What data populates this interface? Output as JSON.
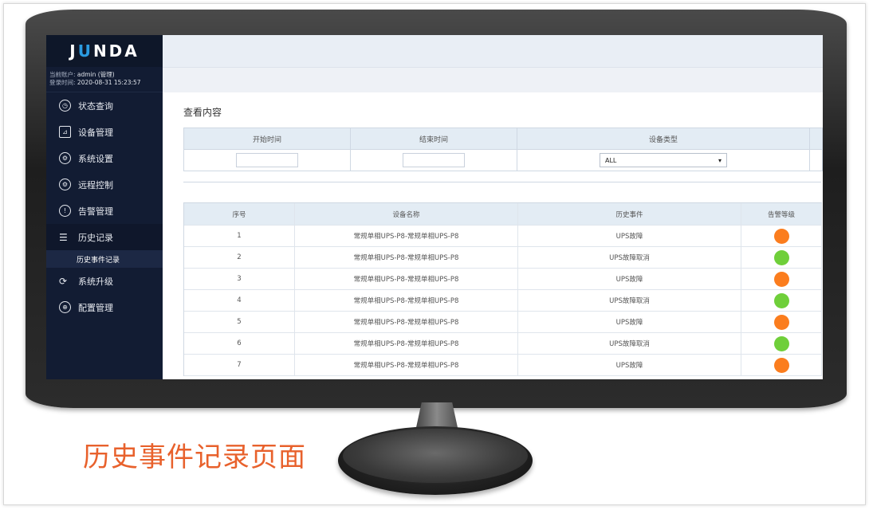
{
  "colors": {
    "alarm": "#fb7d1e",
    "cleared": "#6fcf3a",
    "sidebar": "#121c33",
    "caption": "#e8612c"
  },
  "logo": {
    "left": "J",
    "accent": "U",
    "right": "NDA"
  },
  "user": {
    "account_label": "当前账户:",
    "account_value": "admin (管理)",
    "login_label": "登录时间:",
    "login_value": "2020-08-31 15:23:57"
  },
  "sidebar": {
    "items": [
      {
        "label": "状态查询",
        "icon": "clock-icon"
      },
      {
        "label": "设备管理",
        "icon": "chart-icon"
      },
      {
        "label": "系统设置",
        "icon": "gear-icon"
      },
      {
        "label": "远程控制",
        "icon": "gear-icon"
      },
      {
        "label": "告警管理",
        "icon": "alert-icon"
      },
      {
        "label": "历史记录",
        "icon": "list-icon"
      },
      {
        "label": "系统升级",
        "icon": "refresh-icon"
      },
      {
        "label": "配置管理",
        "icon": "globe-icon"
      }
    ],
    "sub_item": "历史事件记录"
  },
  "page_title": "查看内容",
  "filter": {
    "start_label": "开始时间",
    "end_label": "结束时间",
    "type_label": "设备类型",
    "start_value": "",
    "end_value": "",
    "type_value": "ALL"
  },
  "table": {
    "headers": [
      "序号",
      "设备名称",
      "历史事件",
      "告警等级"
    ],
    "rows": [
      {
        "index": "1",
        "device": "常规单相UPS-P8-常规单相UPS-P8",
        "event": "UPS故障",
        "level": "alarm"
      },
      {
        "index": "2",
        "device": "常规单相UPS-P8-常规单相UPS-P8",
        "event": "UPS故障取消",
        "level": "cleared"
      },
      {
        "index": "3",
        "device": "常规单相UPS-P8-常规单相UPS-P8",
        "event": "UPS故障",
        "level": "alarm"
      },
      {
        "index": "4",
        "device": "常规单相UPS-P8-常规单相UPS-P8",
        "event": "UPS故障取消",
        "level": "cleared"
      },
      {
        "index": "5",
        "device": "常规单相UPS-P8-常规单相UPS-P8",
        "event": "UPS故障",
        "level": "alarm"
      },
      {
        "index": "6",
        "device": "常规单相UPS-P8-常规单相UPS-P8",
        "event": "UPS故障取消",
        "level": "cleared"
      },
      {
        "index": "7",
        "device": "常规单相UPS-P8-常规单相UPS-P8",
        "event": "UPS故障",
        "level": "alarm"
      }
    ]
  },
  "caption": "历史事件记录页面"
}
